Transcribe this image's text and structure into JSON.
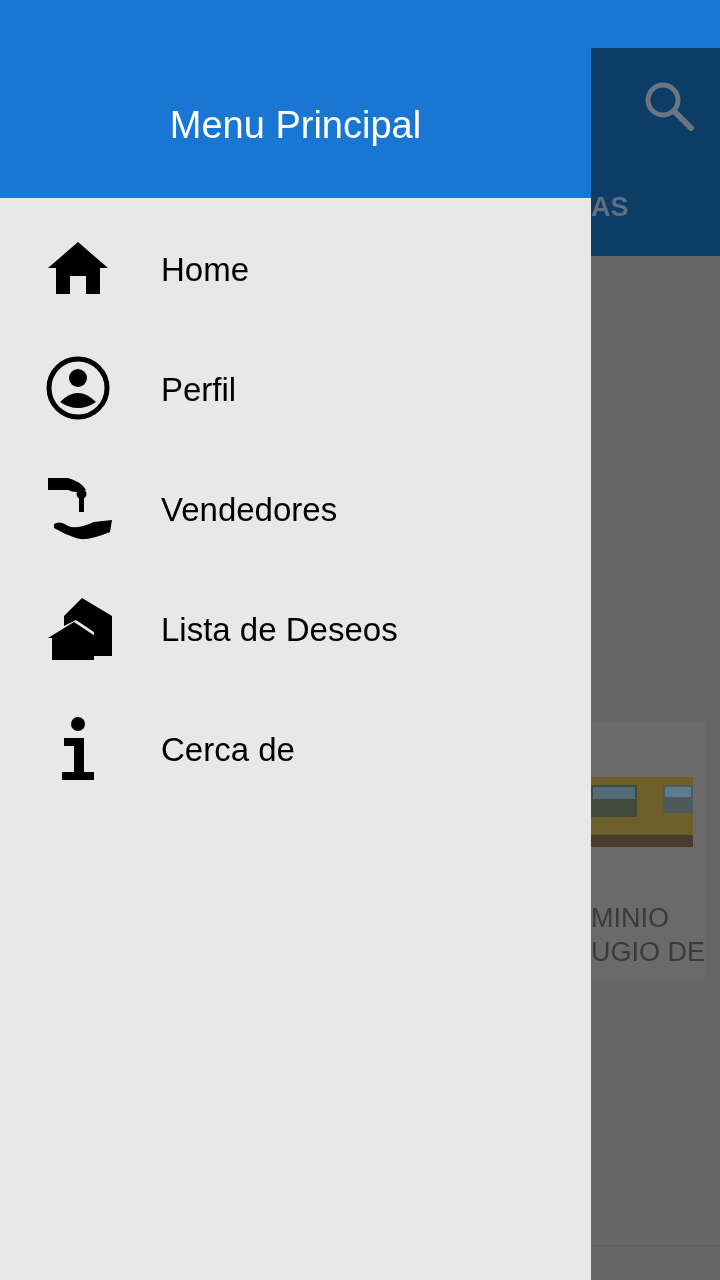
{
  "drawer": {
    "title": "Menu Principal",
    "items": [
      {
        "label": "Home"
      },
      {
        "label": "Perfil"
      },
      {
        "label": "Vendedores"
      },
      {
        "label": "Lista de Deseos"
      },
      {
        "label": "Cerca de"
      }
    ]
  },
  "background": {
    "tab_label": "AS",
    "card": {
      "lines": [
        "MINIO",
        "UGIO DE"
      ]
    }
  }
}
